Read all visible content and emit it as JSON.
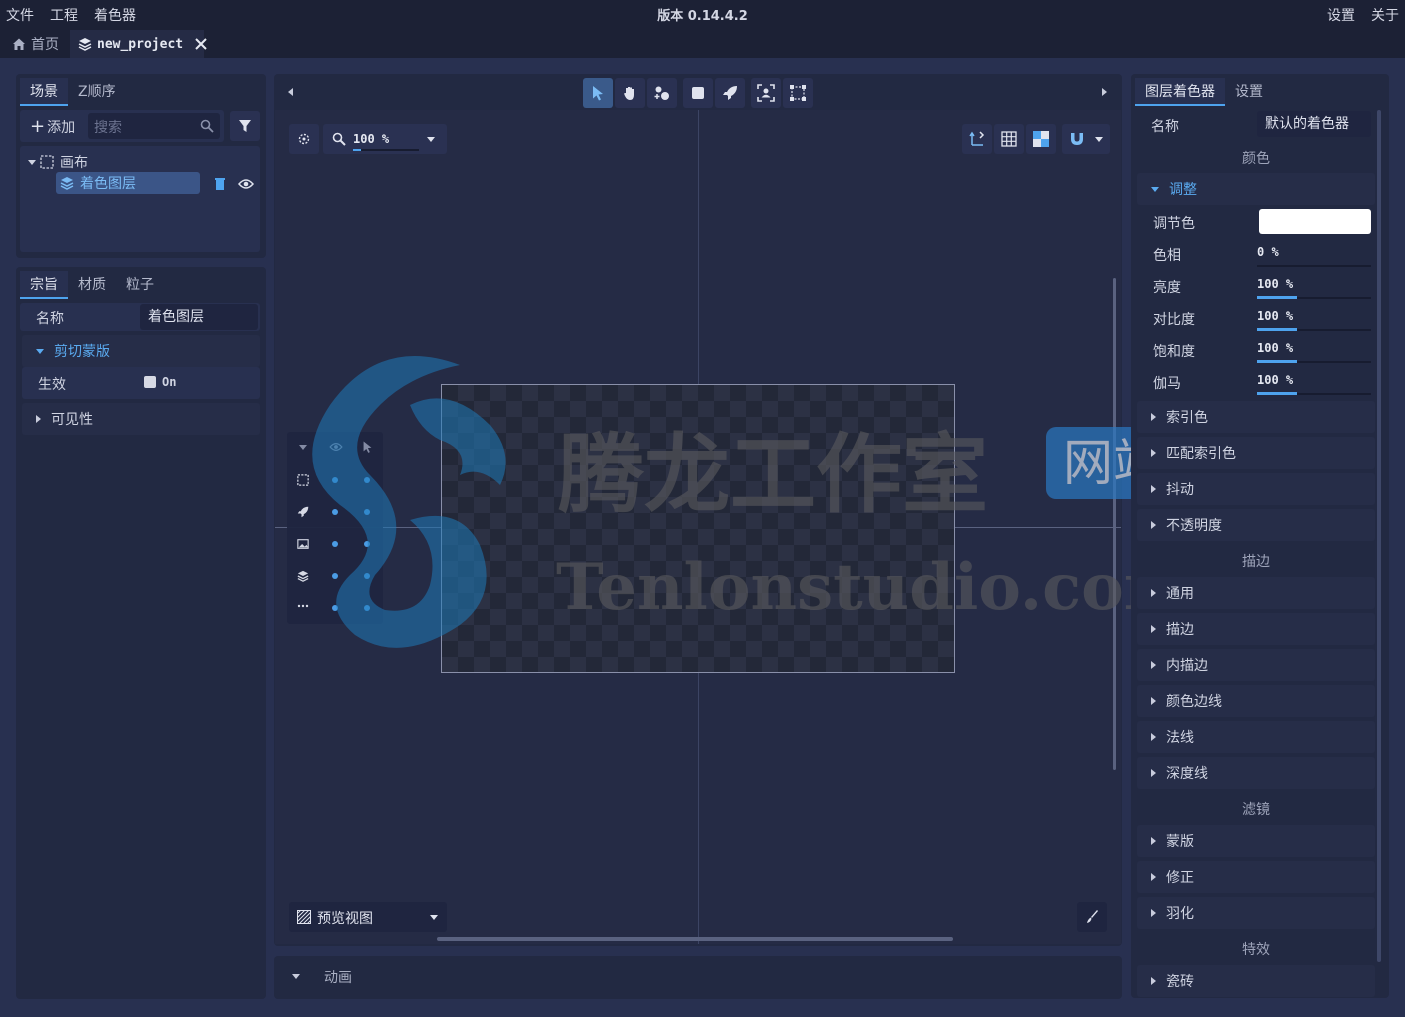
{
  "menubar": {
    "file": "文件",
    "project": "工程",
    "shader": "着色器",
    "version": "版本 0.14.4.2",
    "settings": "设置",
    "about": "关于"
  },
  "tabs": {
    "home": "首页",
    "project": "new_project"
  },
  "scene_panel": {
    "tabs": [
      "场景",
      "Z顺序"
    ],
    "add_label": "添加",
    "search_placeholder": "搜索",
    "tree": {
      "canvas": "画布",
      "layer": "着色图层"
    }
  },
  "props_panel": {
    "tabs": [
      "宗旨",
      "材质",
      "粒子"
    ],
    "name_label": "名称",
    "name_value": "着色图层",
    "clip_section": "剪切蒙版",
    "enabled_label": "生效",
    "enabled_value": "On",
    "visibility_section": "可见性"
  },
  "viewport": {
    "zoom": "100 %",
    "preview_label": "预览视图",
    "animation_label": "动画"
  },
  "watermark": {
    "cn": "腾龙工作室",
    "badge": "网站",
    "en": "Tenlonstudio.com"
  },
  "right_panel": {
    "tabs": [
      "图层着色器",
      "设置"
    ],
    "name_label": "名称",
    "name_value": "默认的着色器",
    "color_group": "颜色",
    "adjust_section": "调整",
    "adjust_rows": [
      {
        "label": "调节色",
        "value": ""
      },
      {
        "label": "色相",
        "value": "0 %",
        "fraction": 0
      },
      {
        "label": "亮度",
        "value": "100 %",
        "fraction": 0.35
      },
      {
        "label": "对比度",
        "value": "100 %",
        "fraction": 0.35
      },
      {
        "label": "饱和度",
        "value": "100 %",
        "fraction": 0.35
      },
      {
        "label": "伽马",
        "value": "100 %",
        "fraction": 0.35
      }
    ],
    "color_sections": [
      "索引色",
      "匹配索引色",
      "抖动",
      "不透明度"
    ],
    "stroke_group": "描边",
    "stroke_sections": [
      "通用",
      "描边",
      "内描边",
      "颜色边线",
      "法线",
      "深度线"
    ],
    "filter_group": "滤镜",
    "filter_sections": [
      "蒙版",
      "修正",
      "羽化"
    ],
    "effect_group": "特效",
    "effect_sections": [
      "瓷砖"
    ]
  },
  "colors": {
    "accent": "#4ea3ee",
    "bg": "#1c2135",
    "panel": "#222942"
  }
}
